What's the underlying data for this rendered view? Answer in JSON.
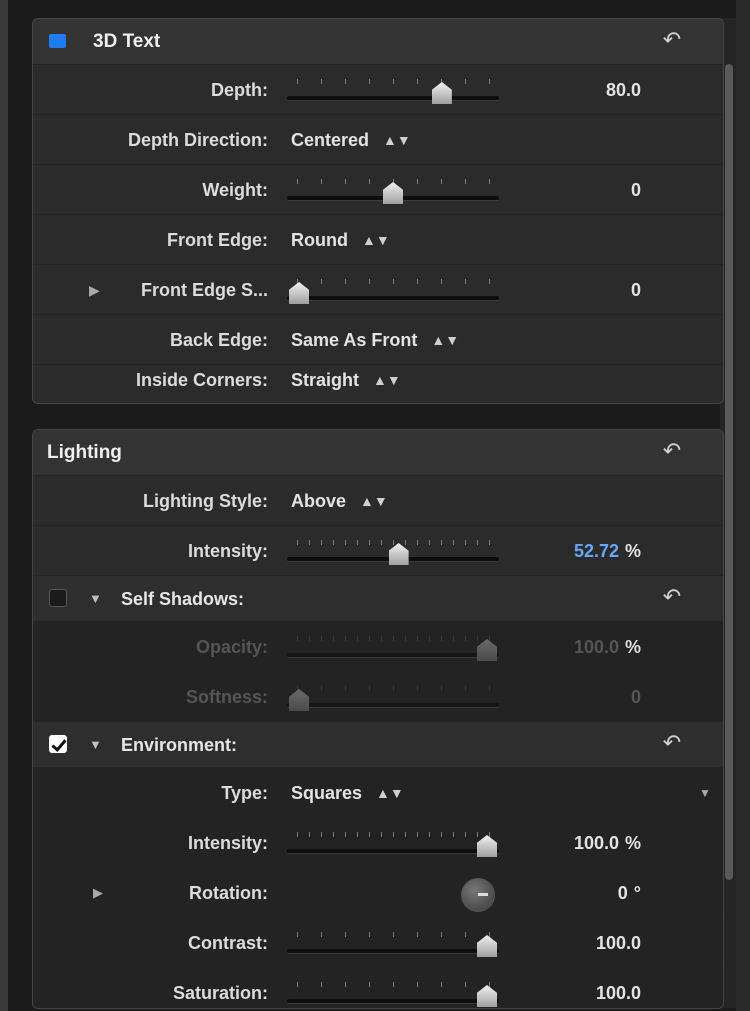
{
  "panel_3d": {
    "title": "3D Text",
    "accent_color": "#1e7bf0",
    "reset_icon": "reset-icon",
    "rows": {
      "depth": {
        "label": "Depth:",
        "value": "80.0",
        "level": 0.76
      },
      "depth_direction": {
        "label": "Depth Direction:",
        "value": "Centered"
      },
      "weight": {
        "label": "Weight:",
        "value": "0",
        "level": 0.5
      },
      "front_edge": {
        "label": "Front Edge:",
        "value": "Round"
      },
      "front_edge_size": {
        "label": "Front Edge S...",
        "value": "0",
        "level": 0.0
      },
      "back_edge": {
        "label": "Back Edge:",
        "value": "Same As Front"
      },
      "inside_corners": {
        "label": "Inside Corners:",
        "value": "Straight"
      }
    }
  },
  "panel_lighting": {
    "title": "Lighting",
    "reset_icon": "reset-icon",
    "rows": {
      "lighting_style": {
        "label": "Lighting Style:",
        "value": "Above"
      },
      "intensity": {
        "label": "Intensity:",
        "value": "52.72",
        "unit": "%",
        "level": 0.53,
        "value_color": "#6aa6ff"
      }
    },
    "self_shadows": {
      "title": "Self Shadows:",
      "checked": false,
      "opacity": {
        "label": "Opacity:",
        "value": "100.0",
        "unit": "%",
        "level": 1.0
      },
      "softness": {
        "label": "Softness:",
        "value": "0",
        "level": 0.0
      }
    },
    "environment": {
      "title": "Environment:",
      "checked": true,
      "type": {
        "label": "Type:",
        "value": "Squares"
      },
      "intensity": {
        "label": "Intensity:",
        "value": "100.0",
        "unit": "%",
        "level": 1.0
      },
      "rotation": {
        "label": "Rotation:",
        "value": "0",
        "unit": "°"
      },
      "contrast": {
        "label": "Contrast:",
        "value": "100.0",
        "level": 1.0
      },
      "saturation": {
        "label": "Saturation:",
        "value": "100.0",
        "level": 1.0
      }
    }
  }
}
